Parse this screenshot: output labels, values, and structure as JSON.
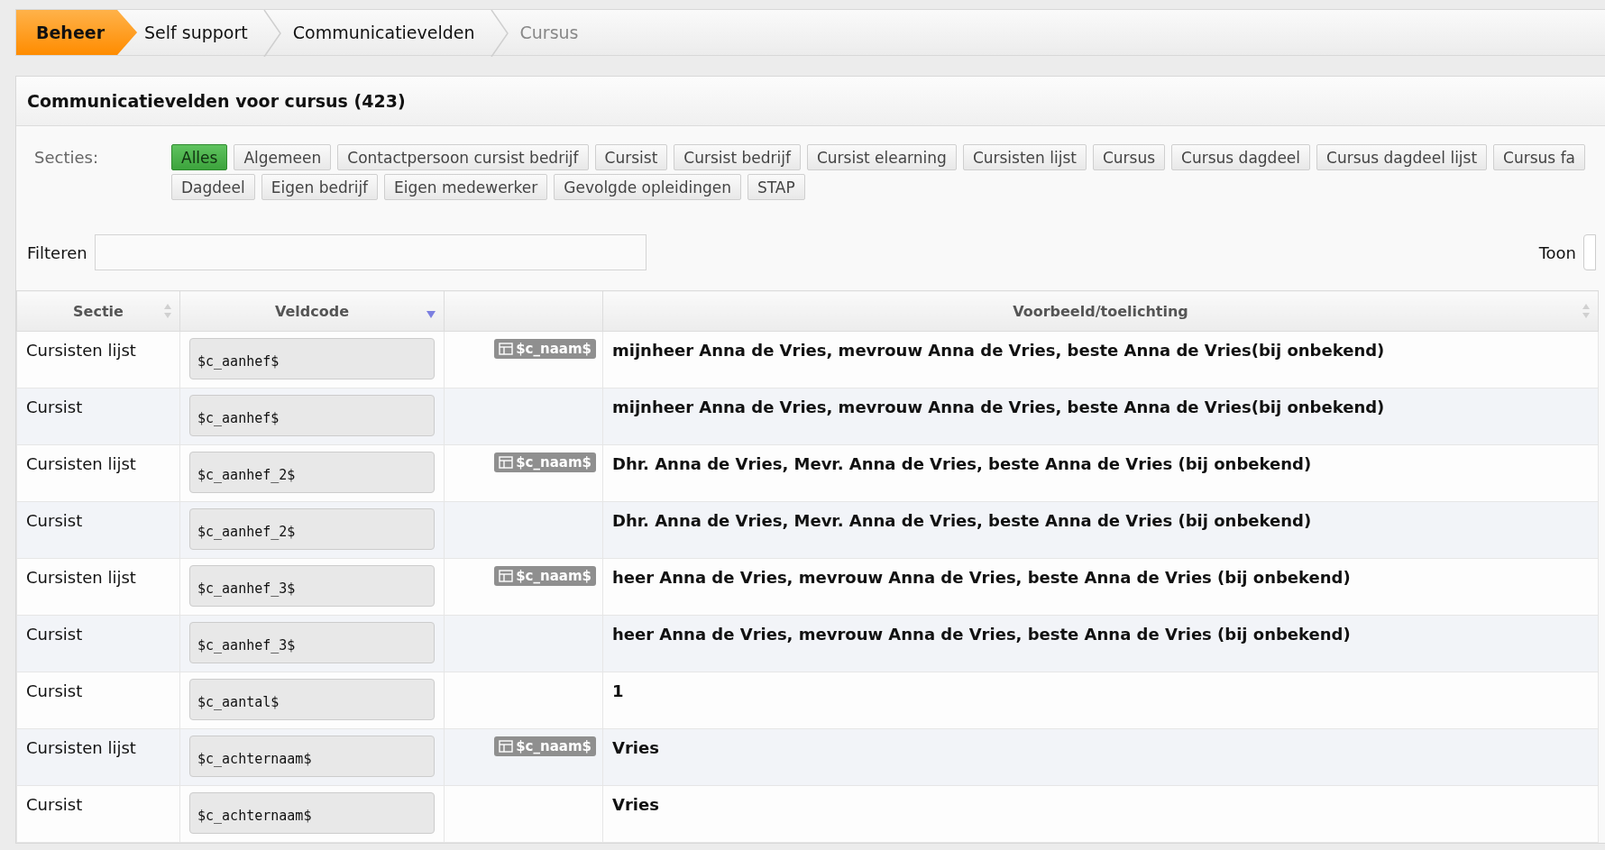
{
  "breadcrumb": [
    {
      "label": "Beheer",
      "selected": true
    },
    {
      "label": "Self support",
      "selected": false
    },
    {
      "label": "Communicatievelden",
      "selected": false
    },
    {
      "label": "Cursus",
      "selected": false
    }
  ],
  "panel": {
    "title": "Communicatievelden voor cursus (423)",
    "sections_label": "Secties:",
    "sections": [
      {
        "label": "Alles",
        "selected": true
      },
      {
        "label": "Algemeen",
        "selected": false
      },
      {
        "label": "Contactpersoon cursist bedrijf",
        "selected": false
      },
      {
        "label": "Cursist",
        "selected": false
      },
      {
        "label": "Cursist bedrijf",
        "selected": false
      },
      {
        "label": "Cursist elearning",
        "selected": false
      },
      {
        "label": "Cursisten lijst",
        "selected": false
      },
      {
        "label": "Cursus",
        "selected": false
      },
      {
        "label": "Cursus dagdeel",
        "selected": false
      },
      {
        "label": "Cursus dagdeel lijst",
        "selected": false
      },
      {
        "label": "Cursus fa",
        "selected": false
      },
      {
        "label": "Dagdeel",
        "selected": false
      },
      {
        "label": "Eigen bedrijf",
        "selected": false
      },
      {
        "label": "Eigen medewerker",
        "selected": false
      },
      {
        "label": "Gevolgde opleidingen",
        "selected": false
      },
      {
        "label": "STAP",
        "selected": false
      }
    ],
    "filter_label": "Filteren",
    "show_label": "Toon",
    "table": {
      "columns": [
        {
          "label": "Sectie",
          "sortable": true,
          "sorted": false
        },
        {
          "label": "Veldcode",
          "sortable": true,
          "sorted": true
        },
        {
          "sortable": false
        },
        {
          "label": "Voorbeeld/toelichting",
          "sortable": true,
          "sorted": false
        }
      ],
      "rows": [
        {
          "section": "Cursisten lijst",
          "code": "$c_aanhef$",
          "badge": "$c_naam$",
          "example": "mijnheer Anna de Vries, mevrouw Anna de Vries, beste Anna de Vries(bij onbekend)"
        },
        {
          "section": "Cursist",
          "code": "$c_aanhef$",
          "example": "mijnheer Anna de Vries, mevrouw Anna de Vries, beste Anna de Vries(bij onbekend)"
        },
        {
          "section": "Cursisten lijst",
          "code": "$c_aanhef_2$",
          "badge": "$c_naam$",
          "example": "Dhr. Anna de Vries, Mevr. Anna de Vries, beste Anna de Vries (bij onbekend)"
        },
        {
          "section": "Cursist",
          "code": "$c_aanhef_2$",
          "example": "Dhr. Anna de Vries, Mevr. Anna de Vries, beste Anna de Vries (bij onbekend)"
        },
        {
          "section": "Cursisten lijst",
          "code": "$c_aanhef_3$",
          "badge": "$c_naam$",
          "example": "heer Anna de Vries, mevrouw Anna de Vries, beste Anna de Vries (bij onbekend)"
        },
        {
          "section": "Cursist",
          "code": "$c_aanhef_3$",
          "example": "heer Anna de Vries, mevrouw Anna de Vries, beste Anna de Vries (bij onbekend)"
        },
        {
          "section": "Cursist",
          "code": "$c_aantal$",
          "example": "1"
        },
        {
          "section": "Cursisten lijst",
          "code": "$c_achternaam$",
          "badge": "$c_naam$",
          "example": "Vries"
        },
        {
          "section": "Cursist",
          "code": "$c_achternaam$",
          "example": "Vries"
        }
      ]
    }
  }
}
